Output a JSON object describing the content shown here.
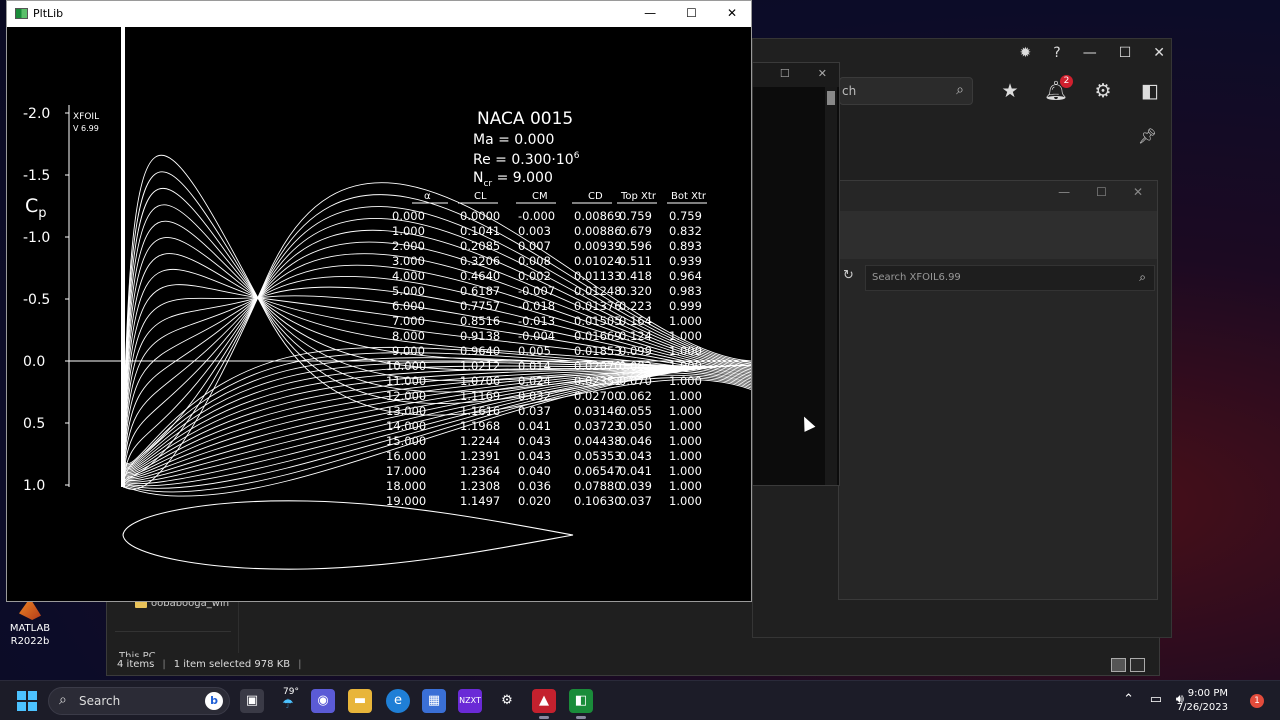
{
  "desktop": {
    "matlab_icon": {
      "line1": "MATLAB",
      "line2": "R2022b"
    }
  },
  "explorer": {
    "folder_label": "oobabooga_win",
    "this_pc": "This PC",
    "status_items": "4 items",
    "status_selected": "1 item selected  978 KB"
  },
  "dark_app": {
    "search_text": "ch",
    "notification_count": "2",
    "icons": [
      "bug-icon",
      "help-icon",
      "star-icon",
      "bell-icon",
      "gear-icon",
      "panel-icon",
      "pin-icon"
    ]
  },
  "inner_window": {
    "search_placeholder": "Search XFOIL6.99"
  },
  "pltlib": {
    "window_title": "PltLib",
    "plot": {
      "program": "XFOIL",
      "version": "V 6.99",
      "airfoil": "NACA 0015",
      "mach": "Ma = 0.000",
      "reynolds": "Re = 0.300·10",
      "reynolds_exp": "6",
      "ncrit_prefix": "N",
      "ncrit_sub": "cr",
      "ncrit_value": " = 9.000",
      "cp_label": "C",
      "cp_sub": "p",
      "y_ticks": [
        "-2.0",
        "-1.5",
        "-1.0",
        "-0.5",
        "0.0",
        "0.5",
        "1.0"
      ],
      "table_headers": [
        "α",
        "CL",
        "CM",
        "CD",
        "Top Xtr",
        "Bot Xtr"
      ],
      "table_rows": [
        [
          "0.000",
          "0.0000",
          "-0.000",
          "0.00869",
          "0.759",
          "0.759"
        ],
        [
          "1.000",
          "0.1041",
          "0.003",
          "0.00886",
          "0.679",
          "0.832"
        ],
        [
          "2.000",
          "0.2085",
          "0.007",
          "0.00939",
          "0.596",
          "0.893"
        ],
        [
          "3.000",
          "0.3206",
          "0.008",
          "0.01024",
          "0.511",
          "0.939"
        ],
        [
          "4.000",
          "0.4640",
          "0.002",
          "0.01133",
          "0.418",
          "0.964"
        ],
        [
          "5.000",
          "0.6187",
          "-0.007",
          "0.01248",
          "0.320",
          "0.983"
        ],
        [
          "6.000",
          "0.7757",
          "-0.018",
          "0.01376",
          "0.223",
          "0.999"
        ],
        [
          "7.000",
          "0.8516",
          "-0.013",
          "0.01505",
          "0.164",
          "1.000"
        ],
        [
          "8.000",
          "0.9138",
          "-0.004",
          "0.01669",
          "0.124",
          "1.000"
        ],
        [
          "9.000",
          "0.9640",
          "0.005",
          "0.01853",
          "0.099",
          "1.000"
        ],
        [
          "10.000",
          "1.0212",
          "0.014",
          "0.02070",
          "0.082",
          "1.000"
        ],
        [
          "11.000",
          "1.0706",
          "0.024",
          "0.02351",
          "0.070",
          "1.000"
        ],
        [
          "12.000",
          "1.1169",
          "0.032",
          "0.02700",
          "0.062",
          "1.000"
        ],
        [
          "13.000",
          "1.1616",
          "0.037",
          "0.03146",
          "0.055",
          "1.000"
        ],
        [
          "14.000",
          "1.1968",
          "0.041",
          "0.03723",
          "0.050",
          "1.000"
        ],
        [
          "15.000",
          "1.2244",
          "0.043",
          "0.04438",
          "0.046",
          "1.000"
        ],
        [
          "16.000",
          "1.2391",
          "0.043",
          "0.05353",
          "0.043",
          "1.000"
        ],
        [
          "17.000",
          "1.2364",
          "0.040",
          "0.06547",
          "0.041",
          "1.000"
        ],
        [
          "18.000",
          "1.2308",
          "0.036",
          "0.07880",
          "0.039",
          "1.000"
        ],
        [
          "19.000",
          "1.1497",
          "0.020",
          "0.10630",
          "0.037",
          "1.000"
        ]
      ]
    }
  },
  "taskbar": {
    "search_label": "Search",
    "weather_temp": "79°",
    "time": "9:00 PM",
    "date": "7/26/2023",
    "notification_count": "1"
  }
}
